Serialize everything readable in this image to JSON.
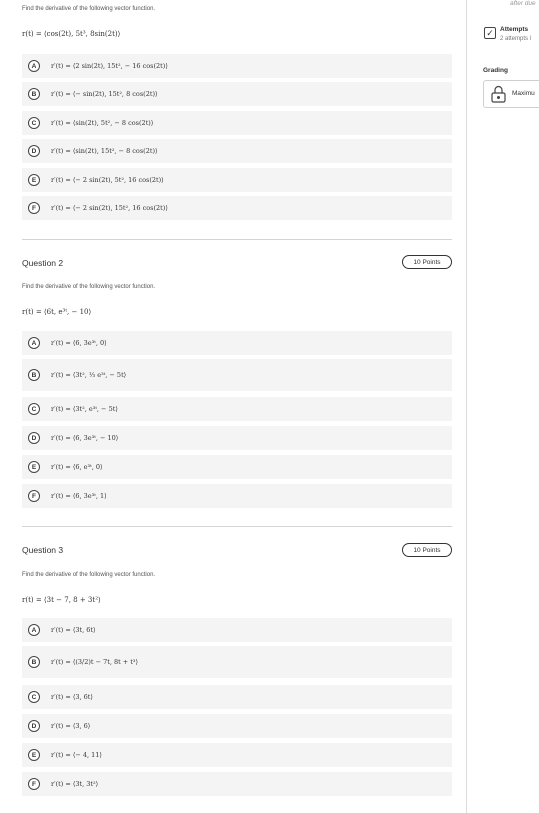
{
  "questions": [
    {
      "title": "",
      "points": "",
      "prompt": "Find the derivative of the following vector function.",
      "function": "r(t) = ⟨cos(2t), 5t³, 8sin(2t)⟩",
      "choices": [
        {
          "letter": "A",
          "text": "r′(t) = ⟨2 sin(2t),  15t²,  − 16 cos(2t)⟩"
        },
        {
          "letter": "B",
          "text": "r′(t) = ⟨− sin(2t),  15t²,  8 cos(2t)⟩"
        },
        {
          "letter": "C",
          "text": "r′(t) = ⟨sin(2t),  5t²,  − 8 cos(2t)⟩"
        },
        {
          "letter": "D",
          "text": "r′(t) = ⟨sin(2t),  15t²,  − 8 cos(2t)⟩"
        },
        {
          "letter": "E",
          "text": "r′(t) = ⟨− 2 sin(2t),  5t²,  16 cos(2t)⟩"
        },
        {
          "letter": "F",
          "text": "r′(t) = ⟨− 2 sin(2t),  15t²,  16 cos(2t)⟩"
        }
      ]
    },
    {
      "title": "Question 2",
      "points": "10 Points",
      "prompt": "Find the derivative of the following vector function.",
      "function": "r(t) = ⟨6t, e³ᵗ, − 10⟩",
      "choices": [
        {
          "letter": "A",
          "text": "r′(t) = ⟨6,  3e³ᵗ,  0⟩"
        },
        {
          "letter": "B",
          "text": "r′(t) = ⟨3t²,  ⅓ e³ᵗ,  − 5t⟩"
        },
        {
          "letter": "C",
          "text": "r′(t) = ⟨3t²,  e³ᵗ,  − 5t⟩"
        },
        {
          "letter": "D",
          "text": "r′(t) = ⟨6,  3e³ᵗ,  − 10⟩"
        },
        {
          "letter": "E",
          "text": "r′(t) = ⟨6,  e³ᵗ,  0⟩"
        },
        {
          "letter": "F",
          "text": "r′(t) = ⟨6,  3e³ᵗ,  1⟩"
        }
      ]
    },
    {
      "title": "Question 3",
      "points": "10 Points",
      "prompt": "Find the derivative of the following vector function.",
      "function": "r(t) = ⟨3t − 7, 8 + 3t²⟩",
      "choices": [
        {
          "letter": "A",
          "text": "r′(t) = ⟨3t,  6t⟩"
        },
        {
          "letter": "B",
          "text": "r′(t) = ⟨(3/2)t − 7t,  8t + t³⟩"
        },
        {
          "letter": "C",
          "text": "r′(t) = ⟨3,  6t⟩"
        },
        {
          "letter": "D",
          "text": "r′(t) = ⟨3,  6⟩"
        },
        {
          "letter": "E",
          "text": "r′(t) = ⟨− 4,  11⟩"
        },
        {
          "letter": "F",
          "text": "r′(t) = ⟨3t,  3t²⟩"
        }
      ]
    }
  ],
  "sidebar": {
    "after_due": "after due",
    "attempts_title": "Attempts",
    "attempts_sub": "2 attempts l",
    "grading_label": "Grading",
    "grading_value": "Maximu"
  }
}
